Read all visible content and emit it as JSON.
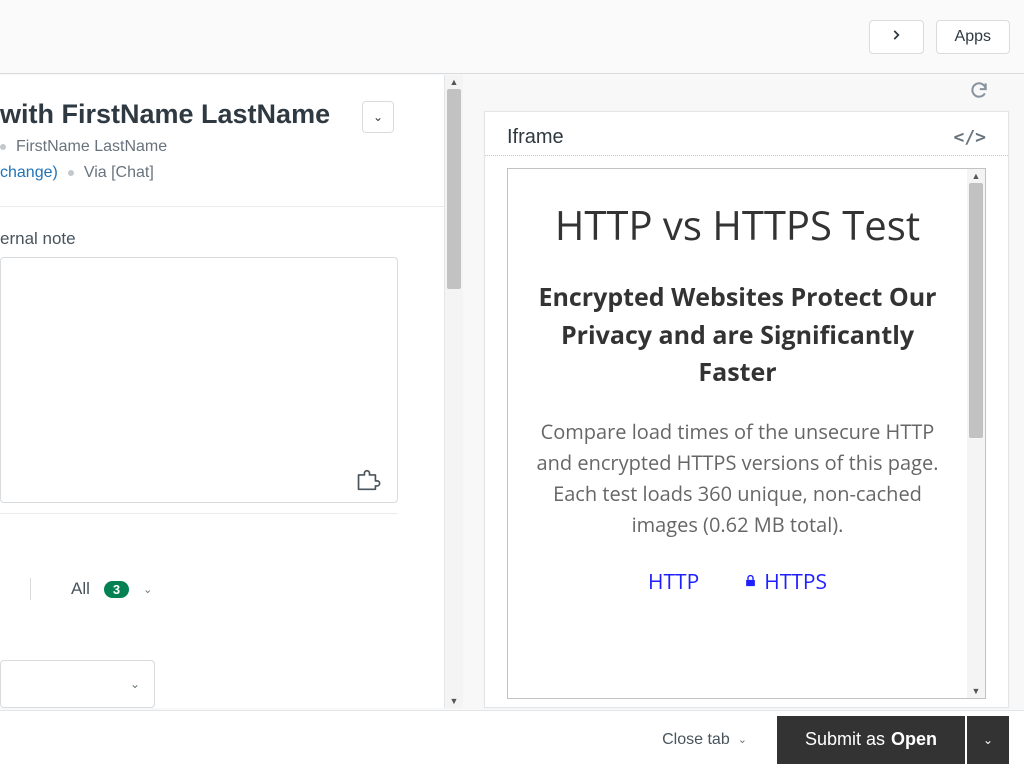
{
  "topbar": {
    "apps_label": "Apps"
  },
  "conversation": {
    "title": "with FirstName LastName",
    "requester": "FirstName LastName",
    "change_link": "change)",
    "via_text": "Via [Chat]",
    "note_tab_label": "ernal note",
    "filter_all_label": "All",
    "filter_all_count": "3"
  },
  "iframe": {
    "header": "Iframe",
    "code_indicator": "</>",
    "h1": "HTTP vs HTTPS Test",
    "h2": "Encrypted Websites Protect Our Privacy and are Significantly Faster",
    "paragraph": "Compare load times of the unsecure HTTP and encrypted HTTPS versions of this page. Each test loads 360 unique, non-cached images (0.62 MB total).",
    "link_http": "HTTP",
    "link_https": "HTTPS"
  },
  "footer": {
    "close_tab": "Close tab",
    "submit_prefix": "Submit as ",
    "submit_status": "Open"
  }
}
